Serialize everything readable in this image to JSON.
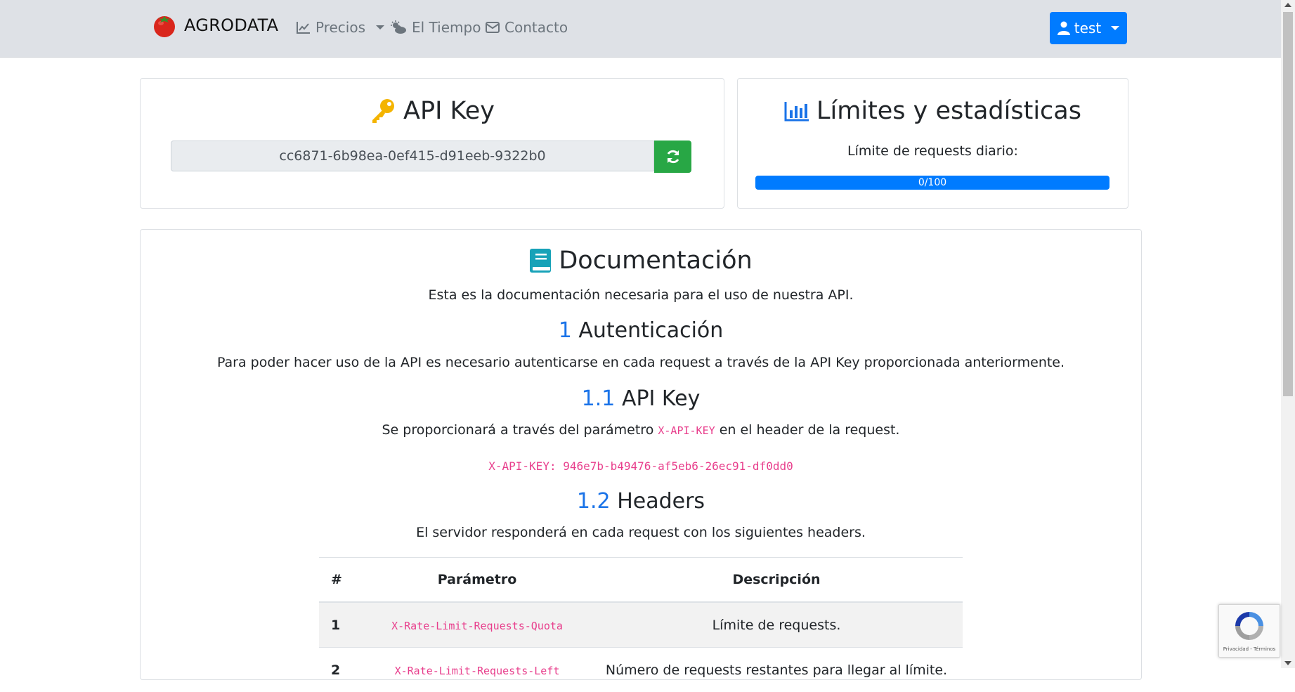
{
  "navbar": {
    "brand": "AGRODATA",
    "links": [
      {
        "label": "Precios",
        "icon": "chart-line-icon",
        "dropdown": true
      },
      {
        "label": "El Tiempo",
        "icon": "cloud-sun-icon"
      },
      {
        "label": "Contacto",
        "icon": "envelope-icon"
      }
    ],
    "user_label": "test"
  },
  "api_key_card": {
    "title": "API Key",
    "key_value": "cc6871-6b98ea-0ef415-d91eeb-9322b0",
    "icon": "key-icon",
    "refresh_icon": "refresh-icon"
  },
  "limits_card": {
    "title": "Límites y estadísticas",
    "limit_label": "Límite de requests diario:",
    "progress_label": "0/100",
    "progress_used": 0,
    "progress_total": 100
  },
  "docs": {
    "title": "Documentación",
    "intro": "Esta es la documentación necesaria para el uso de nuestra API.",
    "auth": {
      "num": "1",
      "title": "Autenticación",
      "text": "Para poder hacer uso de la API es necesario autenticarse en cada request a través de la API Key proporcionada anteriormente."
    },
    "apikey": {
      "num": "1.1",
      "title": "API Key",
      "text_before": "Se proporcionará a través del parámetro",
      "code": "X-API-KEY",
      "text_after": "en el header de la request.",
      "example": "X-API-KEY: 946e7b-b49476-af5eb6-26ec91-df0dd0"
    },
    "headers": {
      "num": "1.2",
      "title": "Headers",
      "text": "El servidor responderá en cada request con los siguientes headers.",
      "columns": [
        "#",
        "Parámetro",
        "Descripción"
      ],
      "rows": [
        {
          "n": "1",
          "param": "X-Rate-Limit-Requests-Quota",
          "desc": "Límite de requests."
        },
        {
          "n": "2",
          "param": "X-Rate-Limit-Requests-Left",
          "desc": "Número de requests restantes para llegar al límite."
        }
      ]
    }
  },
  "recaptcha": {
    "text": "Privacidad - Términos"
  },
  "colors": {
    "primary": "#007bff",
    "success": "#28a745",
    "code": "#e83e8c",
    "navbar": "#dee1e6"
  }
}
